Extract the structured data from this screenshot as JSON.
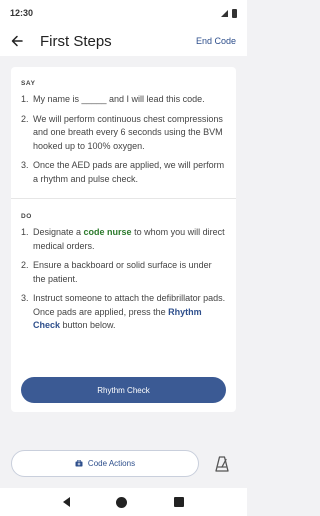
{
  "status_bar": {
    "time": "12:30"
  },
  "header": {
    "title": "First Steps",
    "end_code_label": "End Code"
  },
  "say_section": {
    "label": "SAY",
    "items": [
      {
        "num": "1.",
        "text": "My name is _____ and I will lead this code."
      },
      {
        "num": "2.",
        "text": "We will perform continuous chest compressions and one breath every 6 seconds using the BVM hooked up to 100% oxygen."
      },
      {
        "num": "3.",
        "text": "Once the AED pads are applied, we will perform a rhythm and pulse check."
      }
    ]
  },
  "do_section": {
    "label": "DO",
    "item1": {
      "num": "1.",
      "before": "Designate a ",
      "highlight": "code nurse",
      "after": " to whom you will direct medical orders."
    },
    "item2": {
      "num": "2.",
      "text": "Ensure a backboard or solid surface is under the patient."
    },
    "item3": {
      "num": "3.",
      "before": "Instruct someone to attach the defibrillator pads. Once pads are applied, press the ",
      "highlight": "Rhythm Check",
      "after": " button below."
    }
  },
  "rhythm_check_label": "Rhythm Check",
  "code_actions_label": "Code Actions",
  "colors": {
    "primary": "#3b5a94",
    "accent_blue": "#2e4f8c",
    "accent_green": "#2c7a2c"
  }
}
